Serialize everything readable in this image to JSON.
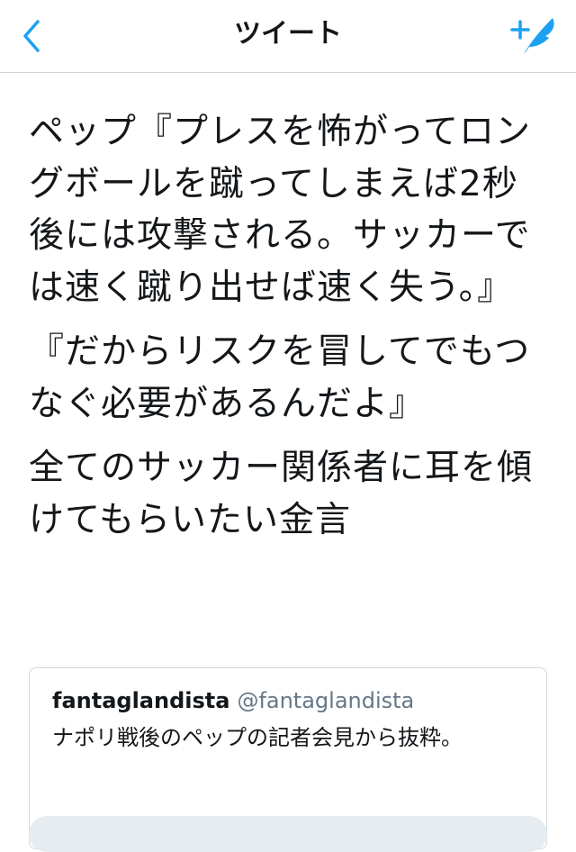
{
  "nav": {
    "title": "ツイート",
    "back_icon": "chevron-left-icon",
    "compose_icon": "compose-feather-icon",
    "accent_color": "#1da1f2"
  },
  "tweet": {
    "paragraphs": [
      "ペップ『プレスを怖がってロングボールを蹴ってしまえば2秒後には攻撃される。サッカーでは速く蹴り出せば速く失う。』",
      "『だからリスクを冒してでもつなぐ必要があるんだよ』",
      "全てのサッカー関係者に耳を傾けてもらいたい金言"
    ]
  },
  "quoted_tweet": {
    "name": "fantaglandista",
    "handle": "@fantaglandista",
    "text": "ナポリ戦後のペップの記者会見から抜粋。"
  }
}
